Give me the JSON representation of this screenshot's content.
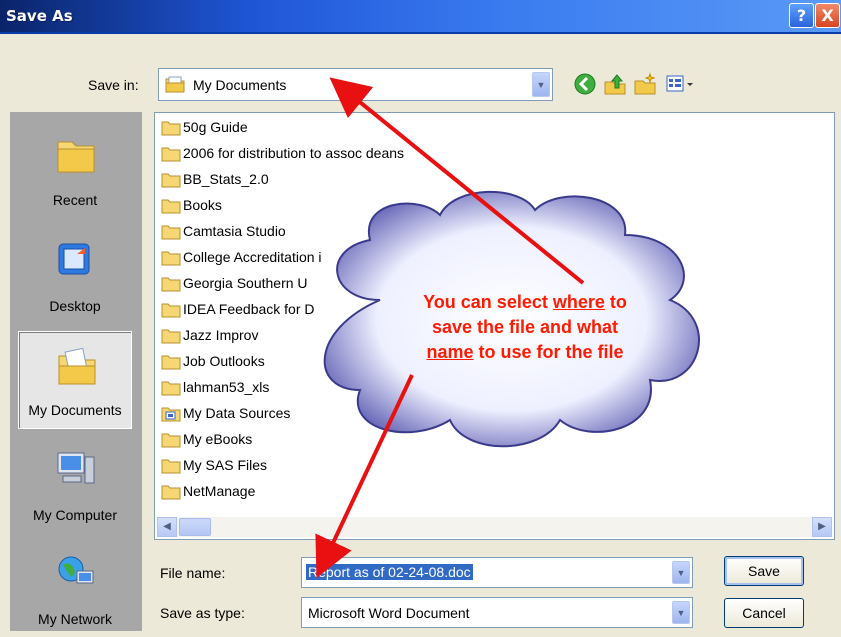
{
  "window": {
    "title": "Save As",
    "help_glyph": "?",
    "close_glyph": "X"
  },
  "save_in": {
    "label": "Save in:",
    "value": "My Documents"
  },
  "toolbar": {
    "icons": [
      "back-icon",
      "up-folder-icon",
      "new-folder-icon",
      "views-menu-icon"
    ]
  },
  "places": [
    {
      "label": "Recent",
      "icon": "recent-folder-icon"
    },
    {
      "label": "Desktop",
      "icon": "desktop-icon"
    },
    {
      "label": "My Documents",
      "icon": "my-documents-icon",
      "active": true
    },
    {
      "label": "My Computer",
      "icon": "my-computer-icon"
    },
    {
      "label": "My Network",
      "icon": "my-network-icon"
    }
  ],
  "files": [
    "50g  Guide",
    "2006 for distribution to assoc deans",
    "BB_Stats_2.0",
    "Books",
    "Camtasia Studio",
    "College Accreditation i",
    "Georgia Southern U",
    "IDEA Feedback for D",
    "Jazz Improv",
    "Job Outlooks",
    "lahman53_xls",
    "My Data Sources",
    "My eBooks",
    "My SAS Files",
    "NetManage"
  ],
  "file_name": {
    "label": "File name:",
    "value": "Report as of 02-24-08.doc"
  },
  "file_type": {
    "label": "Save as type:",
    "value": "Microsoft Word Document"
  },
  "buttons": {
    "save": "Save",
    "cancel": "Cancel"
  },
  "annotation": {
    "line1_pre": "You can select ",
    "line1_u": "where",
    "line1_post": " to",
    "line2": "save the file and what",
    "line3_u": "name",
    "line3_post": " to use for the file",
    "color": "#ff1a00"
  },
  "colors": {
    "accent": "#316ac5",
    "title_bar": "#1f56d6",
    "arrow": "#ff1a00"
  }
}
